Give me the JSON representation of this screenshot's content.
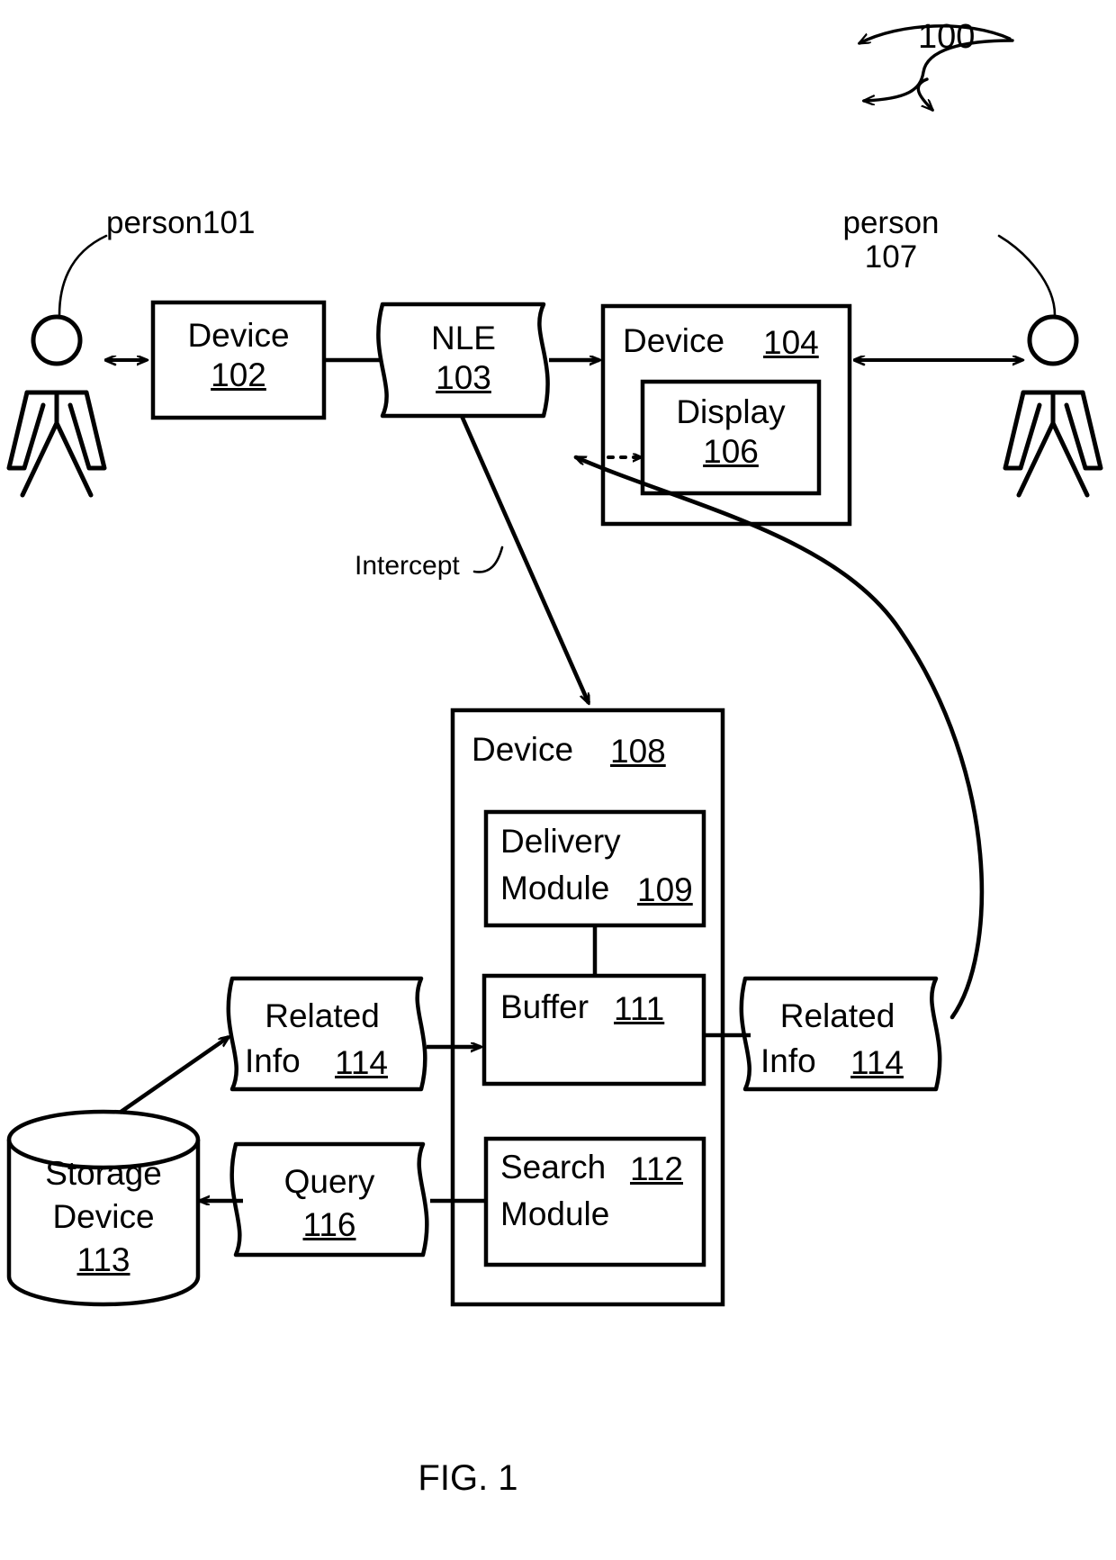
{
  "figure": {
    "caption": "FIG. 1",
    "system_ref": "100"
  },
  "actors": [
    {
      "id": "person101",
      "label": "person101",
      "name": "person-101-label"
    },
    {
      "id": "person107",
      "label_line1": "person",
      "label_line2": "107",
      "name": "person-107-label"
    }
  ],
  "nodes": {
    "device102": {
      "title": "Device",
      "ref": "102"
    },
    "nle103": {
      "title": "NLE",
      "ref": "103"
    },
    "device104": {
      "title": "Device",
      "ref": "104"
    },
    "display106": {
      "title": "Display",
      "ref": "106"
    },
    "device108": {
      "title": "Device",
      "ref": "108"
    },
    "delivery109": {
      "title_line1": "Delivery",
      "title_line2": "Module",
      "ref": "109"
    },
    "buffer111": {
      "title": "Buffer",
      "ref": "111"
    },
    "search112": {
      "title_line1": "Search",
      "title_line2": "Module",
      "ref": "112"
    },
    "storage113": {
      "title_line1": "Storage",
      "title_line2": "Device",
      "ref": "113"
    },
    "relatedinfo114_left": {
      "title_line1": "Related",
      "title_line2": "Info",
      "ref": "114"
    },
    "relatedinfo114_right": {
      "title_line1": "Related",
      "title_line2": "Info",
      "ref": "114"
    },
    "query116": {
      "title": "Query",
      "ref": "116"
    }
  },
  "edges": {
    "intercept_label": "Intercept"
  },
  "colors": {
    "stroke": "#000000",
    "background": "#ffffff"
  }
}
